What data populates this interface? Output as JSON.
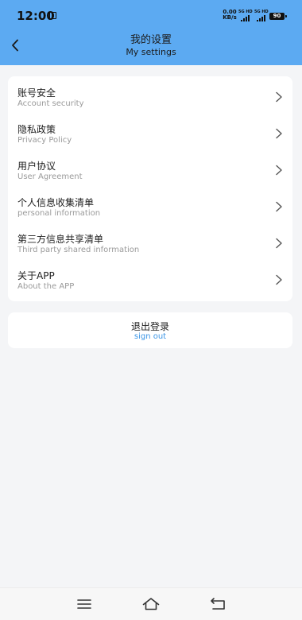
{
  "status_bar": {
    "time": "12:00",
    "net_speed_value": "0.00",
    "net_speed_unit": "KB/s",
    "sim1_tag": "5G HD",
    "sim2_tag": "5G HD",
    "battery": "90"
  },
  "header": {
    "title_cn": "我的设置",
    "title_en": "My settings",
    "back_icon": "chevron-left-icon",
    "background_color": "#5caaf2"
  },
  "menu": {
    "items": [
      {
        "label_cn": "账号安全",
        "label_en": "Account security"
      },
      {
        "label_cn": "隐私政策",
        "label_en": "Privacy Policy"
      },
      {
        "label_cn": "用户协议",
        "label_en": "User Agreement"
      },
      {
        "label_cn": "个人信息收集清单",
        "label_en": "personal information"
      },
      {
        "label_cn": "第三方信息共享清单",
        "label_en": "Third party shared information"
      },
      {
        "label_cn": "关于APP",
        "label_en": "About the APP"
      }
    ],
    "chevron_icon": "chevron-right-icon"
  },
  "signout": {
    "label_cn": "退出登录",
    "label_en": "sign out",
    "accent_color": "#3c96e6"
  },
  "nav_bar": {
    "icons": [
      "menu-icon",
      "home-icon",
      "back-icon"
    ]
  }
}
